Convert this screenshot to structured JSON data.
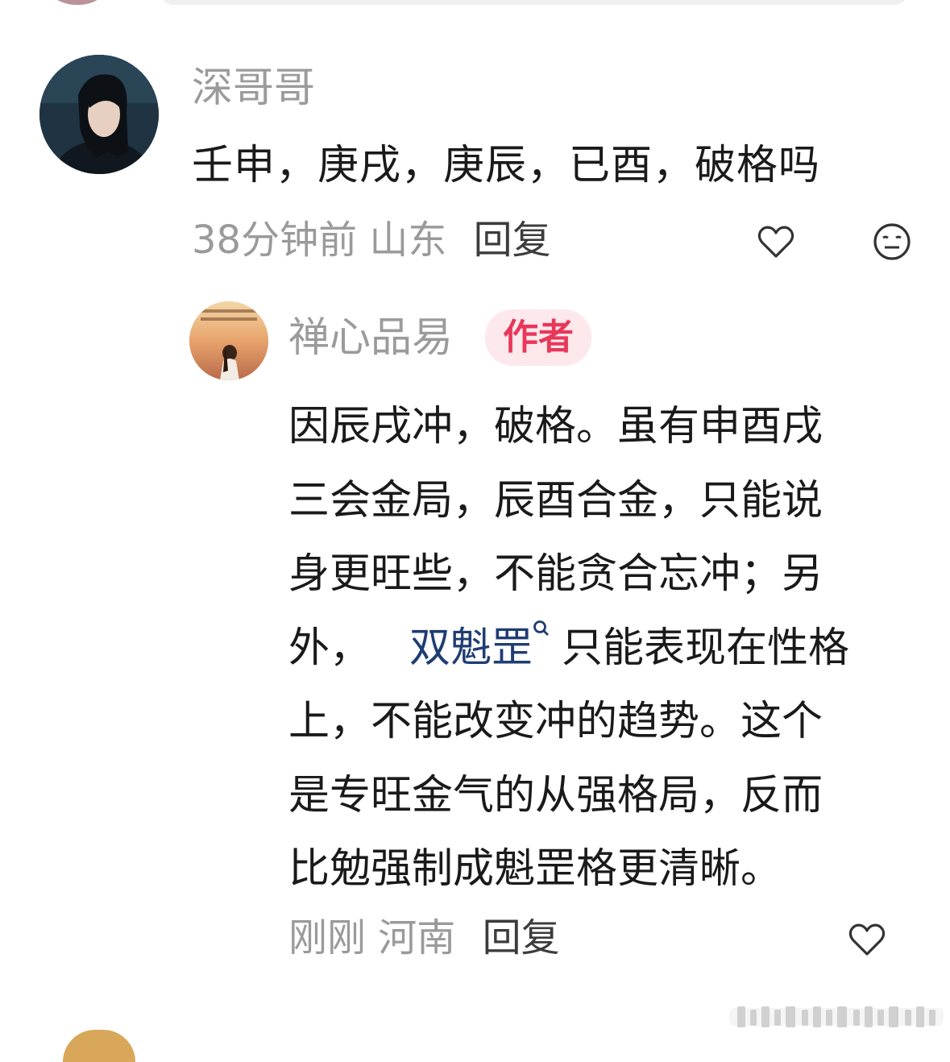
{
  "comment": {
    "username": "深哥哥",
    "text": "壬申，庚戌，庚辰，已酉，破格吗",
    "time": "38分钟前",
    "location": "山东",
    "reply_label": "回复"
  },
  "reply": {
    "username": "禅心品易",
    "author_badge": "作者",
    "lines": [
      "因辰戌冲，破格。虽有申酉戌",
      "三会金局，辰酉合金，只能说",
      "身更旺些，不能贪合忘冲；另",
      "外，",
      "只能表现在性格",
      "上，不能改变冲的趋势。这个",
      "是专旺金气的从强格局，反而",
      "比勉强制成魁罡格更清晰。"
    ],
    "topic_link": "双魁罡",
    "time": "刚刚",
    "location": "河南",
    "reply_label": "回复"
  },
  "colors": {
    "badge_text": "#e8375a",
    "badge_bg": "#fde8ec",
    "topic_link": "#1f3d73",
    "meta_text": "#9a9a9a"
  },
  "icons": [
    "heart-icon",
    "neutral-face-icon",
    "search-icon"
  ]
}
